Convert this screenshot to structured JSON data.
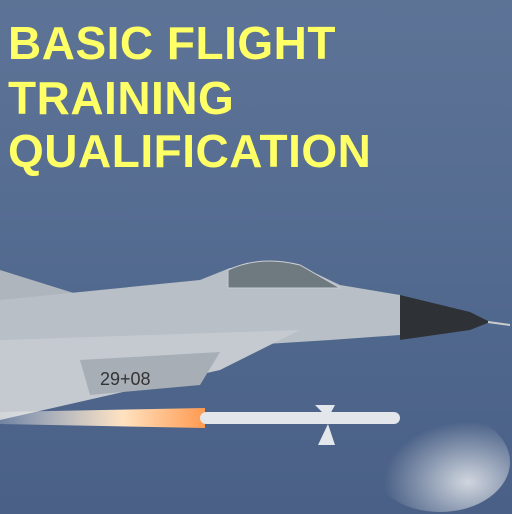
{
  "title_lines": [
    "BASIC FLIGHT",
    "TRAINING",
    "QUALIFICATION"
  ],
  "aircraft_marking": "29+08",
  "colors": {
    "title": "#ffff66",
    "sea": "#566d92",
    "aircraft": "#b9bfc6"
  }
}
